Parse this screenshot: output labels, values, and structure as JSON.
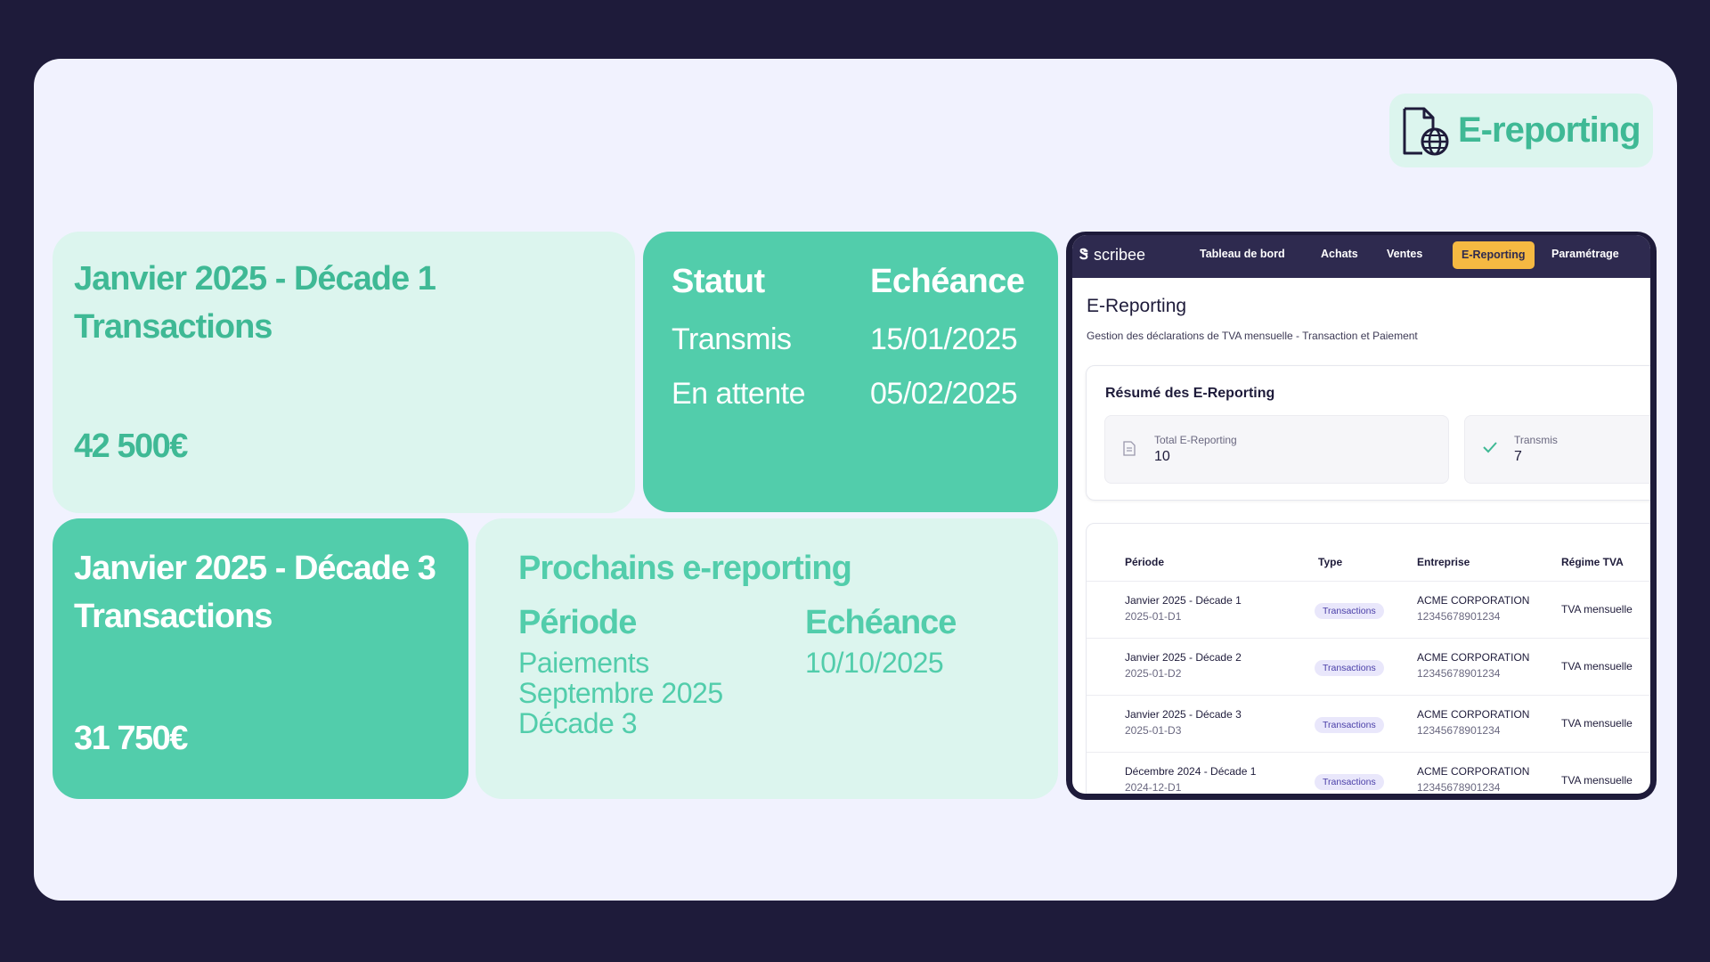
{
  "badge": {
    "label": "E-reporting",
    "icon": "document-globe-icon"
  },
  "card1": {
    "title_line1": "Janvier 2025 - Décade 1",
    "title_line2": "Transactions",
    "amount": "42 500€"
  },
  "card2": {
    "headers": [
      "Statut",
      "Echéance"
    ],
    "rows": [
      {
        "status": "Transmis",
        "date": "15/01/2025"
      },
      {
        "status": "En attente",
        "date": "05/02/2025"
      }
    ]
  },
  "card3": {
    "title_line1": "Janvier 2025 - Décade 3",
    "title_line2": "Transactions",
    "amount": "31 750€"
  },
  "card4": {
    "title": "Prochains e-reporting",
    "col1_header": "Période",
    "col2_header": "Echéance",
    "period_lines": [
      "Paiements",
      "Septembre 2025",
      "Décade 3"
    ],
    "due": "10/10/2025"
  },
  "app": {
    "logo": "scribee",
    "logo_mark": "Ꮥ",
    "nav": [
      "Tableau de bord",
      "Achats",
      "Ventes",
      "E-Reporting",
      "Paramétrage"
    ],
    "active_nav": "E-Reporting",
    "page_title": "E-Reporting",
    "page_subtitle": "Gestion des déclarations de TVA mensuelle - Transaction et Paiement",
    "summary": {
      "title": "Résumé des E-Reporting",
      "stats": [
        {
          "label": "Total E-Reporting",
          "value": "10",
          "icon": "document-icon"
        },
        {
          "label": "Transmis",
          "value": "7",
          "icon": "check-icon"
        }
      ]
    },
    "table": {
      "headers": [
        "Période",
        "Type",
        "Entreprise",
        "Régime TVA"
      ],
      "rows": [
        {
          "period": "Janvier 2025 - Décade 1",
          "id": "2025-01-D1",
          "type": "Transactions",
          "company": "ACME CORPORATION",
          "siret": "12345678901234",
          "regime": "TVA mensuelle"
        },
        {
          "period": "Janvier 2025 - Décade 2",
          "id": "2025-01-D2",
          "type": "Transactions",
          "company": "ACME CORPORATION",
          "siret": "12345678901234",
          "regime": "TVA mensuelle"
        },
        {
          "period": "Janvier 2025 - Décade 3",
          "id": "2025-01-D3",
          "type": "Transactions",
          "company": "ACME CORPORATION",
          "siret": "12345678901234",
          "regime": "TVA mensuelle"
        },
        {
          "period": "Décembre 2024 - Décade 1",
          "id": "2024-12-D1",
          "type": "Transactions",
          "company": "ACME CORPORATION",
          "siret": "12345678901234",
          "regime": "TVA mensuelle"
        }
      ]
    }
  },
  "colors": {
    "background": "#1e1b3a",
    "panel": "#f1f2fe",
    "accent": "#52cdab",
    "accent_light": "#dcf5ee",
    "nav": "#2e2a4f",
    "active": "#f5b942"
  }
}
